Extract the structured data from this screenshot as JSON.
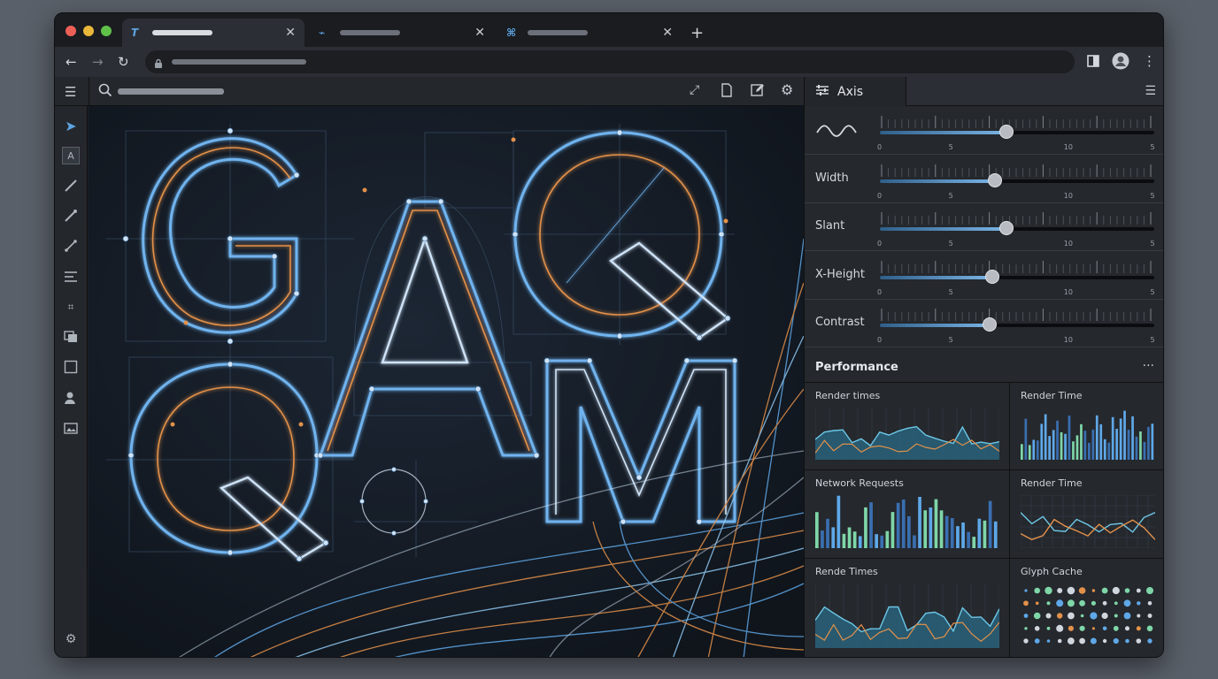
{
  "panel": {
    "title": "Axis"
  },
  "axes": [
    {
      "label": "",
      "icon": "wave-icon",
      "value_fraction": 0.46
    },
    {
      "label": "Width",
      "value_fraction": 0.42
    },
    {
      "label": "Slant",
      "value_fraction": 0.46
    },
    {
      "label": "X-Height",
      "value_fraction": 0.41
    },
    {
      "label": "Contrast",
      "value_fraction": 0.4
    }
  ],
  "axis_ticks": [
    "0",
    "5",
    "10",
    "5"
  ],
  "performance": {
    "title": "Performance",
    "more": "···",
    "charts": [
      {
        "title": "Render times",
        "type": "area"
      },
      {
        "title": "Render Time",
        "type": "bar"
      },
      {
        "title": "Network Requests",
        "type": "bar"
      },
      {
        "title": "Render Time",
        "type": "line"
      },
      {
        "title": "Rende Times",
        "type": "area"
      },
      {
        "title": "Glyph Cache",
        "type": "dots"
      }
    ]
  },
  "colors": {
    "accent": "#5da3e0",
    "orange": "#e48a3a",
    "bg": "#141a22",
    "chrome": "#2b2e34"
  }
}
